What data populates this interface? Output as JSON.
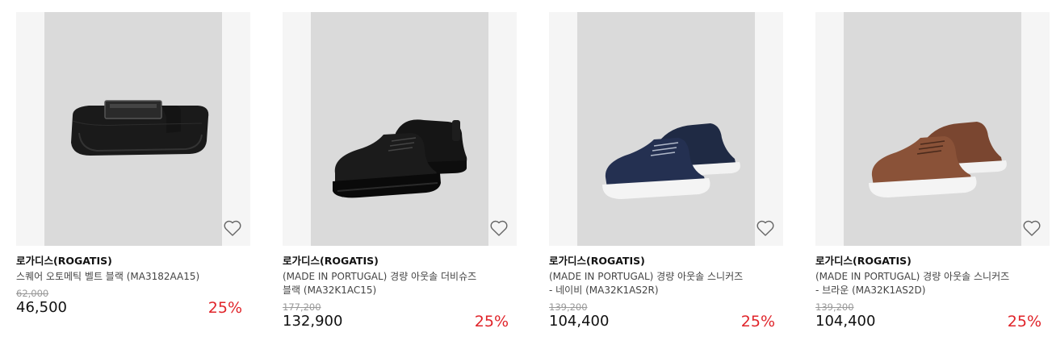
{
  "products": [
    {
      "brand": "로가디스(ROGATIS)",
      "name_line1": "스퀘어 오토메틱 벨트 블랙 (MA3182AA15)",
      "name_line2": "",
      "original_price": "62,000",
      "sale_price": "46,500",
      "discount": "25%",
      "image": "belt-image"
    },
    {
      "brand": "로가디스(ROGATIS)",
      "name_line1": "(MADE IN PORTUGAL) 경량 아웃솔 더비슈즈",
      "name_line2": "블랙 (MA32K1AC15)",
      "original_price": "177,200",
      "sale_price": "132,900",
      "discount": "25%",
      "image": "derby-shoes-image"
    },
    {
      "brand": "로가디스(ROGATIS)",
      "name_line1": "(MADE IN PORTUGAL) 경량 아웃솔 스니커즈",
      "name_line2": "- 네이비 (MA32K1AS2R)",
      "original_price": "139,200",
      "sale_price": "104,400",
      "discount": "25%",
      "image": "navy-sneakers-image"
    },
    {
      "brand": "로가디스(ROGATIS)",
      "name_line1": "(MADE IN PORTUGAL) 경량 아웃솔 스니커즈",
      "name_line2": "- 브라운 (MA32K1AS2D)",
      "original_price": "139,200",
      "sale_price": "104,400",
      "discount": "25%",
      "image": "brown-sneakers-image"
    }
  ],
  "colors": {
    "discount": "#e0242a",
    "image_bg": "#dadada",
    "image_side": "#f5f5f5",
    "navy": "#1f2a44",
    "brown": "#8a5238"
  },
  "icons": {
    "wishlist": "heart-outline-icon"
  }
}
